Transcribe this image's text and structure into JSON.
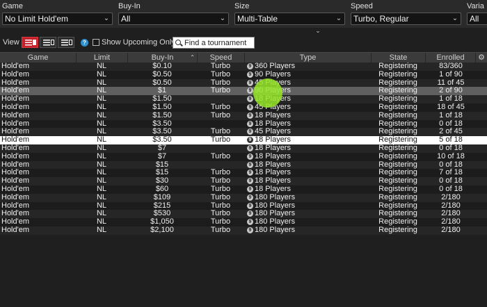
{
  "filters": {
    "game": {
      "label": "Game",
      "value": "No Limit Hold'em"
    },
    "buyin": {
      "label": "Buy-In",
      "value": "All"
    },
    "size": {
      "label": "Size",
      "value": "Multi-Table"
    },
    "speed": {
      "label": "Speed",
      "value": "Turbo, Regular"
    },
    "variant": {
      "label": "Varia",
      "value": "All"
    }
  },
  "toolbar": {
    "view_label": "View",
    "help_glyph": "?",
    "show_upcoming_label": "Show Upcoming Only",
    "search_placeholder": "Find a tournament"
  },
  "table": {
    "headers": {
      "game": "Game",
      "limit": "Limit",
      "buyin": "Buy-In",
      "speed": "Speed",
      "type": "Type",
      "state": "State",
      "enrolled": "Enrolled"
    },
    "badge_glyph": "9",
    "rows": [
      {
        "game": "Hold'em",
        "limit": "NL",
        "buyin": "$0.10",
        "speed": "Turbo",
        "type": "360 Players",
        "state": "Registering",
        "enrolled": "83/360"
      },
      {
        "game": "Hold'em",
        "limit": "NL",
        "buyin": "$0.50",
        "speed": "Turbo",
        "type": "90 Players",
        "state": "Registering",
        "enrolled": "1 of 90"
      },
      {
        "game": "Hold'em",
        "limit": "NL",
        "buyin": "$0.50",
        "speed": "Turbo",
        "type": "45 Players",
        "state": "Registering",
        "enrolled": "11 of 45"
      },
      {
        "game": "Hold'em",
        "limit": "NL",
        "buyin": "$1",
        "speed": "Turbo",
        "type": "90 Players",
        "state": "Registering",
        "enrolled": "2 of 90"
      },
      {
        "game": "Hold'em",
        "limit": "NL",
        "buyin": "$1.50",
        "speed": "",
        "type": "18 Players",
        "state": "Registering",
        "enrolled": "1 of 18"
      },
      {
        "game": "Hold'em",
        "limit": "NL",
        "buyin": "$1.50",
        "speed": "Turbo",
        "type": "45 Players",
        "state": "Registering",
        "enrolled": "18 of 45"
      },
      {
        "game": "Hold'em",
        "limit": "NL",
        "buyin": "$1.50",
        "speed": "Turbo",
        "type": "18 Players",
        "state": "Registering",
        "enrolled": "1 of 18"
      },
      {
        "game": "Hold'em",
        "limit": "NL",
        "buyin": "$3.50",
        "speed": "",
        "type": "18 Players",
        "state": "Registering",
        "enrolled": "0 of 18"
      },
      {
        "game": "Hold'em",
        "limit": "NL",
        "buyin": "$3.50",
        "speed": "Turbo",
        "type": "45 Players",
        "state": "Registering",
        "enrolled": "2 of 45"
      },
      {
        "game": "Hold'em",
        "limit": "NL",
        "buyin": "$3.50",
        "speed": "Turbo",
        "type": "18 Players",
        "state": "Registering",
        "enrolled": "5 of 18"
      },
      {
        "game": "Hold'em",
        "limit": "NL",
        "buyin": "$7",
        "speed": "",
        "type": "18 Players",
        "state": "Registering",
        "enrolled": "0 of 18"
      },
      {
        "game": "Hold'em",
        "limit": "NL",
        "buyin": "$7",
        "speed": "Turbo",
        "type": "18 Players",
        "state": "Registering",
        "enrolled": "10 of 18"
      },
      {
        "game": "Hold'em",
        "limit": "NL",
        "buyin": "$15",
        "speed": "",
        "type": "18 Players",
        "state": "Registering",
        "enrolled": "0 of 18"
      },
      {
        "game": "Hold'em",
        "limit": "NL",
        "buyin": "$15",
        "speed": "Turbo",
        "type": "18 Players",
        "state": "Registering",
        "enrolled": "7 of 18"
      },
      {
        "game": "Hold'em",
        "limit": "NL",
        "buyin": "$30",
        "speed": "Turbo",
        "type": "18 Players",
        "state": "Registering",
        "enrolled": "0 of 18"
      },
      {
        "game": "Hold'em",
        "limit": "NL",
        "buyin": "$60",
        "speed": "Turbo",
        "type": "18 Players",
        "state": "Registering",
        "enrolled": "0 of 18"
      },
      {
        "game": "Hold'em",
        "limit": "NL",
        "buyin": "$109",
        "speed": "Turbo",
        "type": "180 Players",
        "state": "Registering",
        "enrolled": "2/180"
      },
      {
        "game": "Hold'em",
        "limit": "NL",
        "buyin": "$215",
        "speed": "Turbo",
        "type": "180 Players",
        "state": "Registering",
        "enrolled": "2/180"
      },
      {
        "game": "Hold'em",
        "limit": "NL",
        "buyin": "$530",
        "speed": "Turbo",
        "type": "180 Players",
        "state": "Registering",
        "enrolled": "2/180"
      },
      {
        "game": "Hold'em",
        "limit": "NL",
        "buyin": "$1,050",
        "speed": "Turbo",
        "type": "180 Players",
        "state": "Registering",
        "enrolled": "2/180"
      },
      {
        "game": "Hold'em",
        "limit": "NL",
        "buyin": "$2,100",
        "speed": "Turbo",
        "type": "180 Players",
        "state": "Registering",
        "enrolled": "2/180"
      }
    ]
  },
  "colors": {
    "accent": "#c6202b",
    "selected_row": "#ffffff",
    "hover_row": "#606060",
    "cursor_highlight": "#96e628"
  }
}
